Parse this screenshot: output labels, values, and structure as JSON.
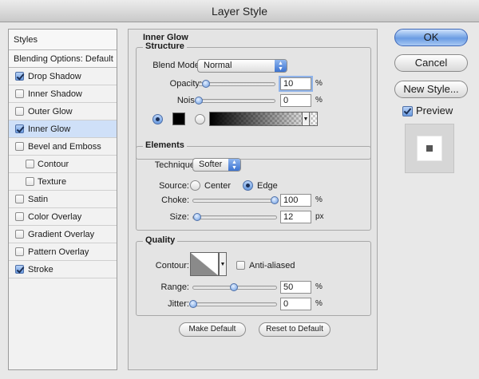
{
  "window": {
    "title": "Layer Style"
  },
  "sidebar": {
    "header": "Styles",
    "blending": "Blending Options: Default",
    "items": [
      {
        "label": "Drop Shadow",
        "checked": true,
        "selected": false,
        "sub": false
      },
      {
        "label": "Inner Shadow",
        "checked": false,
        "selected": false,
        "sub": false
      },
      {
        "label": "Outer Glow",
        "checked": false,
        "selected": false,
        "sub": false
      },
      {
        "label": "Inner Glow",
        "checked": true,
        "selected": true,
        "sub": false
      },
      {
        "label": "Bevel and Emboss",
        "checked": false,
        "selected": false,
        "sub": false
      },
      {
        "label": "Contour",
        "checked": false,
        "selected": false,
        "sub": true
      },
      {
        "label": "Texture",
        "checked": false,
        "selected": false,
        "sub": true
      },
      {
        "label": "Satin",
        "checked": false,
        "selected": false,
        "sub": false
      },
      {
        "label": "Color Overlay",
        "checked": false,
        "selected": false,
        "sub": false
      },
      {
        "label": "Gradient Overlay",
        "checked": false,
        "selected": false,
        "sub": false
      },
      {
        "label": "Pattern Overlay",
        "checked": false,
        "selected": false,
        "sub": false
      },
      {
        "label": "Stroke",
        "checked": true,
        "selected": false,
        "sub": false
      }
    ]
  },
  "panel": {
    "title": "Inner Glow",
    "structure": {
      "title": "Structure",
      "blend_mode_label": "Blend Mode:",
      "blend_mode_value": "Normal",
      "opacity_label": "Opacity:",
      "opacity_value": "10",
      "opacity_unit": "%",
      "noise_label": "Noise:",
      "noise_value": "0",
      "noise_unit": "%",
      "glow_color": "#000000"
    },
    "elements": {
      "title": "Elements",
      "technique_label": "Technique:",
      "technique_value": "Softer",
      "source_label": "Source:",
      "source_center": "Center",
      "source_edge": "Edge",
      "choke_label": "Choke:",
      "choke_value": "100",
      "choke_unit": "%",
      "size_label": "Size:",
      "size_value": "12",
      "size_unit": "px"
    },
    "quality": {
      "title": "Quality",
      "contour_label": "Contour:",
      "anti_aliased_label": "Anti-aliased",
      "range_label": "Range:",
      "range_value": "50",
      "range_unit": "%",
      "jitter_label": "Jitter:",
      "jitter_value": "0",
      "jitter_unit": "%"
    },
    "make_default": "Make Default",
    "reset_default": "Reset to Default"
  },
  "buttons": {
    "ok": "OK",
    "cancel": "Cancel",
    "new_style": "New Style...",
    "preview": "Preview"
  }
}
